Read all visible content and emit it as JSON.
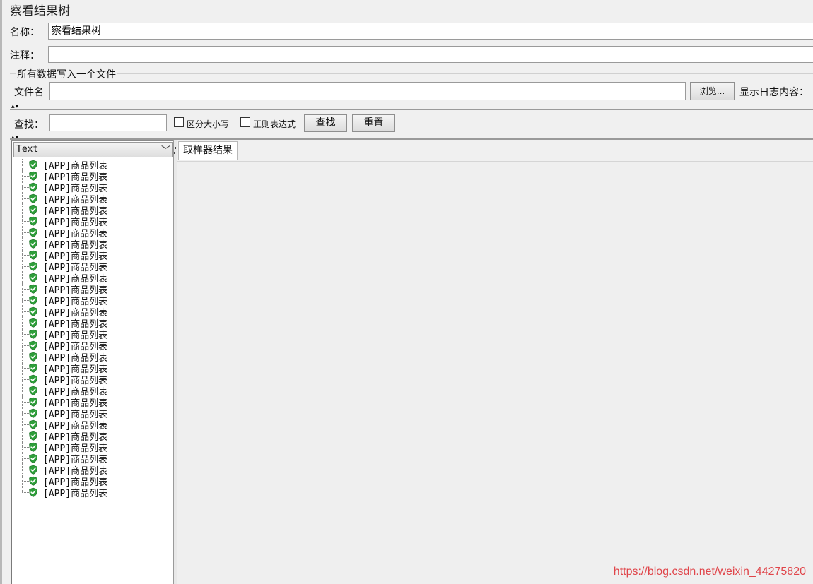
{
  "panel": {
    "title": "察看结果树"
  },
  "form": {
    "name_label": "名称：",
    "name_value": "察看结果树",
    "comment_label": "注释：",
    "comment_value": ""
  },
  "file_group": {
    "title": "所有数据写入一个文件",
    "filename_label": "文件名",
    "filename_value": "",
    "browse_label": "浏览...",
    "log_label": "显示日志内容："
  },
  "search": {
    "label": "查找：",
    "value": "",
    "case_label": "区分大小写",
    "case_checked": false,
    "regex_label": "正则表达式",
    "regex_checked": false,
    "find_label": "查找",
    "reset_label": "重置"
  },
  "tree": {
    "renderer": "Text",
    "status_color": "#2e9e3a",
    "items": [
      "[APP]商品列表",
      "[APP]商品列表",
      "[APP]商品列表",
      "[APP]商品列表",
      "[APP]商品列表",
      "[APP]商品列表",
      "[APP]商品列表",
      "[APP]商品列表",
      "[APP]商品列表",
      "[APP]商品列表",
      "[APP]商品列表",
      "[APP]商品列表",
      "[APP]商品列表",
      "[APP]商品列表",
      "[APP]商品列表",
      "[APP]商品列表",
      "[APP]商品列表",
      "[APP]商品列表",
      "[APP]商品列表",
      "[APP]商品列表",
      "[APP]商品列表",
      "[APP]商品列表",
      "[APP]商品列表",
      "[APP]商品列表",
      "[APP]商品列表",
      "[APP]商品列表",
      "[APP]商品列表",
      "[APP]商品列表",
      "[APP]商品列表",
      "[APP]商品列表"
    ]
  },
  "right": {
    "tab_label": "取样器结果"
  },
  "watermark": "https://blog.csdn.net/weixin_44275820"
}
